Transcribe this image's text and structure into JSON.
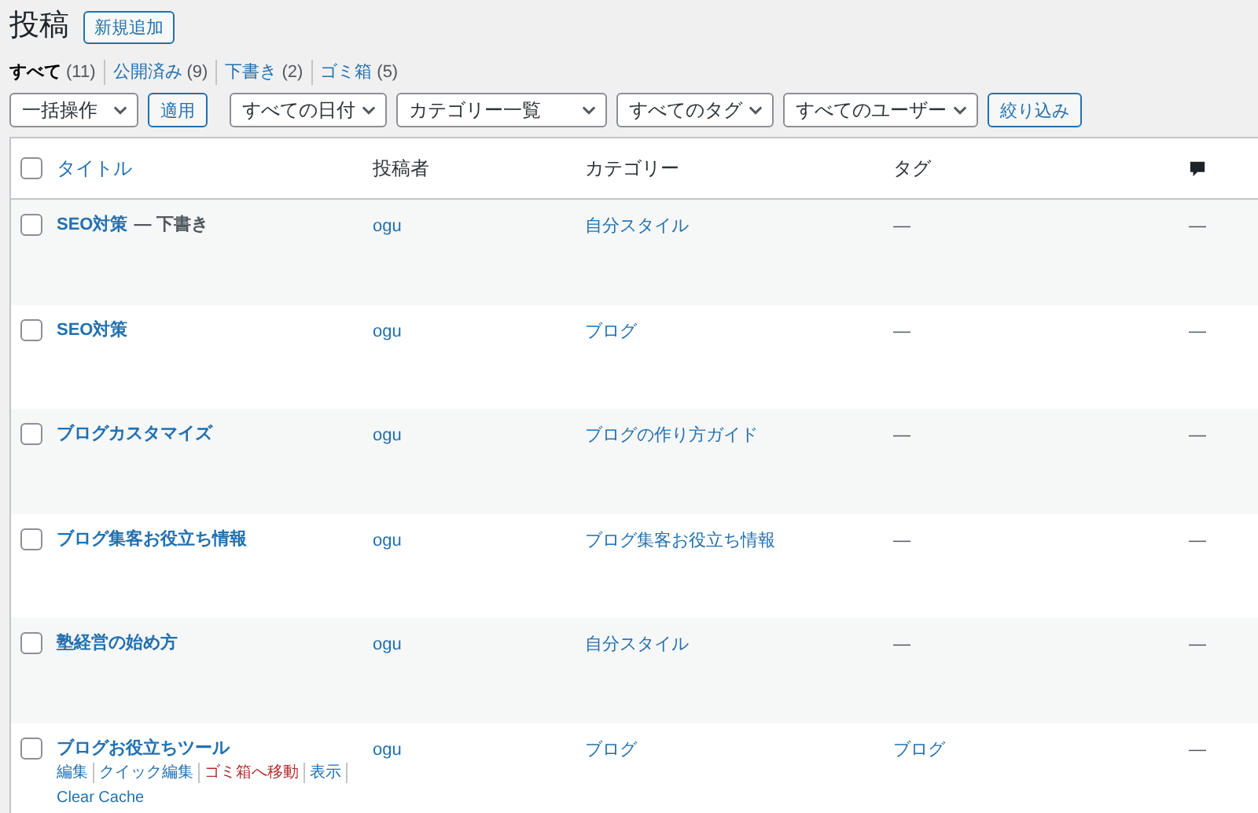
{
  "page_title": "投稿",
  "add_new_button": "新規追加",
  "status_links": [
    {
      "label": "すべて",
      "count": "(11)",
      "selected": true
    },
    {
      "label": "公開済み",
      "count": "(9)",
      "selected": false
    },
    {
      "label": "下書き",
      "count": "(2)",
      "selected": false
    },
    {
      "label": "ゴミ箱",
      "count": "(5)",
      "selected": false
    }
  ],
  "filters": [
    {
      "kind": "dropdown",
      "label": "一括操作"
    },
    {
      "kind": "button",
      "label": "適用"
    },
    {
      "kind": "dropdown",
      "label": "すべての日付"
    },
    {
      "kind": "dropdown",
      "label": "カテゴリー一覧"
    },
    {
      "kind": "dropdown",
      "label": "すべてのタグ"
    },
    {
      "kind": "dropdown",
      "label": "すべてのユーザー"
    },
    {
      "kind": "button",
      "label": "絞り込み"
    }
  ],
  "table": {
    "select_all_checked": false,
    "columns": [
      "タイトル",
      "投稿者",
      "カテゴリー",
      "タグ"
    ],
    "rows": [
      {
        "checked": false,
        "title": "SEO対策",
        "state": "— 下書き",
        "author": "ogu",
        "category": "自分スタイル",
        "tag": "—",
        "comments": "—"
      },
      {
        "checked": false,
        "title": "SEO対策",
        "author": "ogu",
        "category": "ブログ",
        "tag": "—",
        "comments": "—"
      },
      {
        "checked": false,
        "title": "ブログカスタマイズ",
        "author": "ogu",
        "category": "ブログの作り方ガイド",
        "tag": "—",
        "comments": "—"
      },
      {
        "checked": false,
        "title": "ブログ集客お役立ち情報",
        "author": "ogu",
        "category": "ブログ集客お役立ち情報",
        "tag": "—",
        "comments": "—"
      },
      {
        "checked": false,
        "title": "塾経営の始め方",
        "author": "ogu",
        "category": "自分スタイル",
        "tag": "—",
        "comments": "—"
      },
      {
        "checked": false,
        "title": "ブログお役立ちツール",
        "author": "ogu",
        "category": "ブログ",
        "tag": "ブログ",
        "tag_is_link": true,
        "comments": "—",
        "actions": [
          {
            "label": "編集",
            "kind": "normal"
          },
          {
            "label": "クイック編集",
            "kind": "normal"
          },
          {
            "label": "ゴミ箱へ移動",
            "kind": "delete"
          },
          {
            "label": "表示",
            "kind": "normal"
          },
          {
            "label": "Clear Cache",
            "kind": "normal"
          }
        ]
      }
    ]
  }
}
